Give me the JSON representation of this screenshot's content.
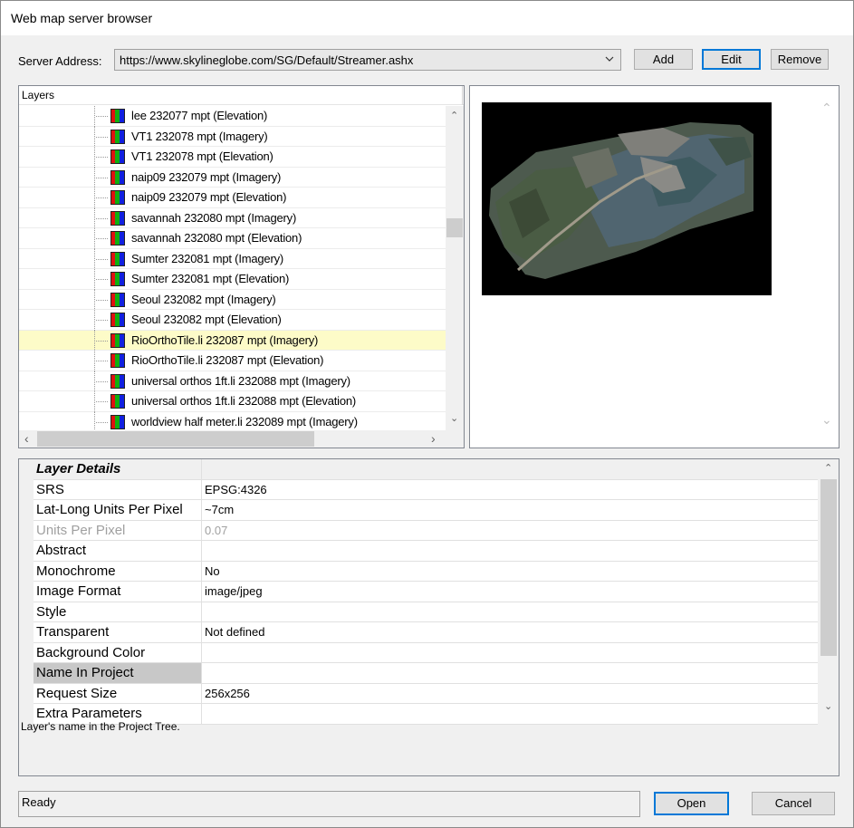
{
  "window": {
    "title": "Web map server browser"
  },
  "server": {
    "label": "Server Address:",
    "address": "https://www.skylineglobe.com/SG/Default/Streamer.ashx",
    "add_label": "Add",
    "edit_label": "Edit",
    "remove_label": "Remove"
  },
  "layers": {
    "header": "Layers",
    "items": [
      {
        "label": "lee 232077 mpt (Elevation)",
        "selected": false
      },
      {
        "label": "VT1 232078 mpt (Imagery)",
        "selected": false
      },
      {
        "label": "VT1 232078 mpt (Elevation)",
        "selected": false
      },
      {
        "label": "naip09 232079 mpt (Imagery)",
        "selected": false
      },
      {
        "label": "naip09 232079 mpt (Elevation)",
        "selected": false
      },
      {
        "label": "savannah 232080 mpt (Imagery)",
        "selected": false
      },
      {
        "label": "savannah 232080 mpt (Elevation)",
        "selected": false
      },
      {
        "label": "Sumter 232081 mpt (Imagery)",
        "selected": false
      },
      {
        "label": "Sumter 232081 mpt (Elevation)",
        "selected": false
      },
      {
        "label": "Seoul 232082 mpt (Imagery)",
        "selected": false
      },
      {
        "label": "Seoul 232082 mpt (Elevation)",
        "selected": false
      },
      {
        "label": "RioOrthoTile.li 232087 mpt (Imagery)",
        "selected": true
      },
      {
        "label": "RioOrthoTile.li 232087 mpt (Elevation)",
        "selected": false
      },
      {
        "label": "universal orthos 1ft.li 232088 mpt (Imagery)",
        "selected": false
      },
      {
        "label": "universal orthos 1ft.li 232088 mpt (Elevation)",
        "selected": false
      },
      {
        "label": "worldview half meter.li 232089 mpt (Imagery)",
        "selected": false
      }
    ]
  },
  "details": {
    "category": "Layer Details",
    "properties": [
      {
        "name": "SRS",
        "value": "EPSG:4326",
        "disabled": false
      },
      {
        "name": "Lat-Long Units Per Pixel",
        "value": "~7cm",
        "disabled": false
      },
      {
        "name": "Units Per Pixel",
        "value": "0.07",
        "disabled": true
      },
      {
        "name": "Abstract",
        "value": "",
        "disabled": false
      },
      {
        "name": "Monochrome",
        "value": "No",
        "disabled": false
      },
      {
        "name": "Image Format",
        "value": "image/jpeg",
        "disabled": false
      },
      {
        "name": "Style",
        "value": "",
        "disabled": false
      },
      {
        "name": "Transparent",
        "value": "Not defined",
        "disabled": false
      },
      {
        "name": "Background Color",
        "value": "",
        "disabled": false
      },
      {
        "name": "Name In Project",
        "value": "",
        "disabled": false,
        "highlighted": true
      },
      {
        "name": "Request Size",
        "value": "256x256",
        "disabled": false
      },
      {
        "name": "Extra Parameters",
        "value": "",
        "disabled": false
      }
    ],
    "description": "Layer's name in the Project Tree."
  },
  "status": {
    "text": "Ready"
  },
  "footer": {
    "open_label": "Open",
    "cancel_label": "Cancel"
  },
  "colors": {
    "selected_row": "#fdfbc8",
    "focus_border": "#0078d7"
  },
  "icons": {
    "layer": "layer-rgb-icon",
    "collapse": "minus-box-icon"
  }
}
